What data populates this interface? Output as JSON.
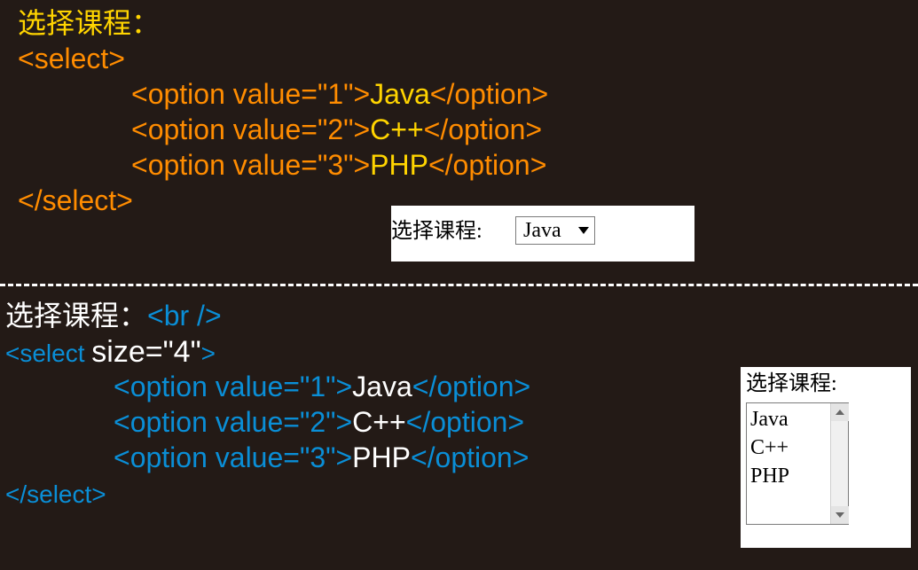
{
  "top": {
    "label": "选择课程：",
    "open": "<select>",
    "o1a": "<option value=\"1\">",
    "o1t": "Java",
    "o1b": "</option>",
    "o2a": "<option value=\"2\">",
    "o2t": "C++",
    "o2b": "</option>",
    "o3a": "<option value=\"3\">",
    "o3t": "PHP",
    "o3b": "</option>",
    "close": "</select>"
  },
  "out1": {
    "label": "选择课程:",
    "selected": "Java"
  },
  "bottom": {
    "labelText": "选择课程：",
    "labelBr": "<br />",
    "selOpen": "<select ",
    "sizeAttr": "size=\"4\"",
    "selOpenEnd": ">",
    "o1a": "<option value=\"1\">",
    "o1t": "Java",
    "o1b": "</option>",
    "o2a": "<option value=\"2\">",
    "o2t": "C++",
    "o2b": "</option>",
    "o3a": "<option value=\"3\">",
    "o3t": "PHP",
    "o3b": "</option>",
    "close": "</select>"
  },
  "out2": {
    "label": "选择课程:",
    "items": {
      "i0": "Java",
      "i1": "C++",
      "i2": "PHP"
    }
  }
}
